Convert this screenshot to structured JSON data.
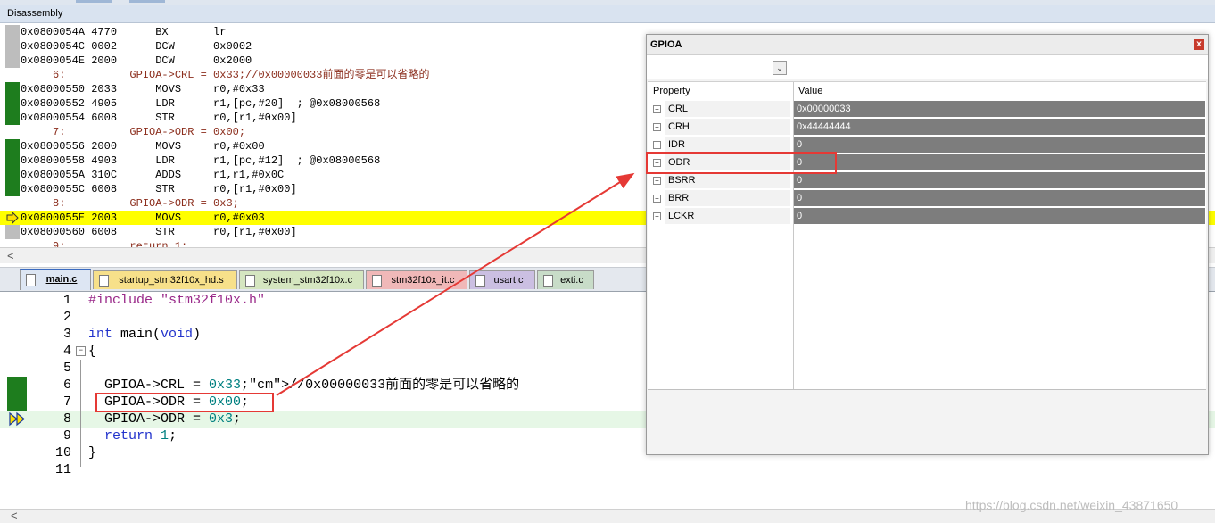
{
  "disassembly": {
    "title": "Disassembly",
    "rows": [
      {
        "text": "0x0800054A 4770      BX       lr",
        "kind": "asm",
        "marker": "gray"
      },
      {
        "text": "0x0800054C 0002      DCW      0x0002",
        "kind": "asm",
        "marker": "gray"
      },
      {
        "text": "0x0800054E 2000      DCW      0x2000",
        "kind": "asm",
        "marker": "gray"
      },
      {
        "text": "     6:          GPIOA->CRL = 0x33;//0x00000033前面的零是可以省略的",
        "kind": "src",
        "marker": "none"
      },
      {
        "text": "0x08000550 2033      MOVS     r0,#0x33",
        "kind": "asm",
        "marker": "green"
      },
      {
        "text": "0x08000552 4905      LDR      r1,[pc,#20]  ; @0x08000568",
        "kind": "asm",
        "marker": "green"
      },
      {
        "text": "0x08000554 6008      STR      r0,[r1,#0x00]",
        "kind": "asm",
        "marker": "green"
      },
      {
        "text": "     7:          GPIOA->ODR = 0x00;",
        "kind": "src",
        "marker": "none"
      },
      {
        "text": "0x08000556 2000      MOVS     r0,#0x00",
        "kind": "asm",
        "marker": "green"
      },
      {
        "text": "0x08000558 4903      LDR      r1,[pc,#12]  ; @0x08000568",
        "kind": "asm",
        "marker": "green"
      },
      {
        "text": "0x0800055A 310C      ADDS     r1,r1,#0x0C",
        "kind": "asm",
        "marker": "green"
      },
      {
        "text": "0x0800055C 6008      STR      r0,[r1,#0x00]",
        "kind": "asm",
        "marker": "green"
      },
      {
        "text": "     8:          GPIOA->ODR = 0x3;",
        "kind": "src",
        "marker": "none"
      },
      {
        "text": "0x0800055E 2003      MOVS     r0,#0x03",
        "kind": "asm",
        "marker": "current"
      },
      {
        "text": "0x08000560 6008      STR      r0,[r1,#0x00]",
        "kind": "asm",
        "marker": "gray"
      },
      {
        "text": "     9:          return 1;",
        "kind": "src",
        "marker": "none"
      }
    ],
    "highlight_color": "#ffff00",
    "exec_color": "#1e7d1e"
  },
  "tabs": [
    {
      "label": "main.c",
      "color": "#dde6f3",
      "active": true
    },
    {
      "label": "startup_stm32f10x_hd.s",
      "color": "#f7e08a",
      "active": false
    },
    {
      "label": "system_stm32f10x.c",
      "color": "#d5e6c0",
      "active": false
    },
    {
      "label": "stm32f10x_it.c",
      "color": "#f0b8b8",
      "active": false
    },
    {
      "label": "usart.c",
      "color": "#cbbfe2",
      "active": false
    },
    {
      "label": "exti.c",
      "color": "#c8dcc8",
      "active": false
    }
  ],
  "editor": {
    "lines": [
      {
        "num": "1",
        "code": "#include \"stm32f10x.h\"",
        "marker": "none"
      },
      {
        "num": "2",
        "code": "",
        "marker": "none"
      },
      {
        "num": "3",
        "code": "int main(void)",
        "marker": "none"
      },
      {
        "num": "4",
        "code": "{",
        "marker": "fold"
      },
      {
        "num": "5",
        "code": "",
        "marker": "none"
      },
      {
        "num": "6",
        "code": "  GPIOA->CRL = 0x33;//0x00000033前面的零是可以省略的",
        "marker": "green"
      },
      {
        "num": "7",
        "code": "  GPIOA->ODR = 0x00;",
        "marker": "green"
      },
      {
        "num": "8",
        "code": "  GPIOA->ODR = 0x3;",
        "marker": "current"
      },
      {
        "num": "9",
        "code": "  return 1;",
        "marker": "none"
      },
      {
        "num": "10",
        "code": "}",
        "marker": "none"
      },
      {
        "num": "11",
        "code": "",
        "marker": "none"
      }
    ]
  },
  "gpio_window": {
    "title": "GPIOA",
    "close_label": "x",
    "combo_arrow": "⌄",
    "col_property": "Property",
    "col_value": "Value",
    "rows": [
      {
        "name": "CRL",
        "value": "0x00000033"
      },
      {
        "name": "CRH",
        "value": "0x44444444"
      },
      {
        "name": "IDR",
        "value": "0"
      },
      {
        "name": "ODR",
        "value": "0"
      },
      {
        "name": "BSRR",
        "value": "0"
      },
      {
        "name": "BRR",
        "value": "0"
      },
      {
        "name": "LCKR",
        "value": "0"
      }
    ]
  },
  "annotation_color": "#e53935",
  "watermark": "https://blog.csdn.net/weixin_43871650"
}
